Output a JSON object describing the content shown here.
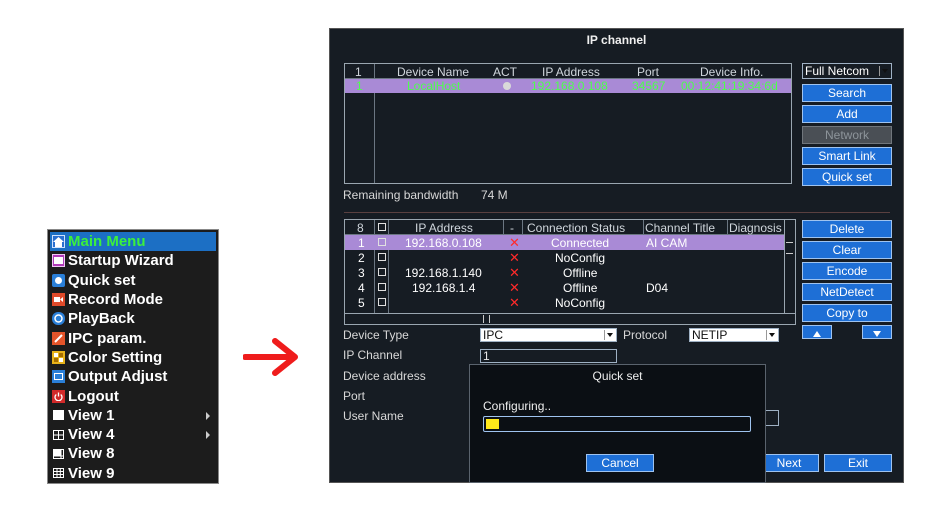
{
  "menu": {
    "items": [
      {
        "label": "Main Menu",
        "icon": "home-icon"
      },
      {
        "label": "Startup Wizard",
        "icon": "wizard-icon"
      },
      {
        "label": "Quick set",
        "icon": "quickset-icon"
      },
      {
        "label": "Record Mode",
        "icon": "record-icon"
      },
      {
        "label": "PlayBack",
        "icon": "playback-icon"
      },
      {
        "label": "IPC param.",
        "icon": "ipc-param-icon"
      },
      {
        "label": "Color Setting",
        "icon": "color-setting-icon"
      },
      {
        "label": "Output Adjust",
        "icon": "output-adjust-icon"
      },
      {
        "label": "Logout",
        "icon": "logout-icon"
      },
      {
        "label": "View 1",
        "icon": "view1-icon"
      },
      {
        "label": "View 4",
        "icon": "view4-icon"
      },
      {
        "label": "View 8",
        "icon": "view8-icon"
      },
      {
        "label": "View 9",
        "icon": "view9-icon"
      }
    ],
    "colors": {
      "selected_bg": "#1c6fc4",
      "selected_text": "#3cf03c"
    }
  },
  "window": {
    "title": "IP channel",
    "netcom_select": "Full Netcom",
    "search_table": {
      "count": "1",
      "headers": [
        "Device Name",
        "ACT",
        "IP Address",
        "Port",
        "Device Info."
      ],
      "rows": [
        {
          "index": "1",
          "name": "LocalHost",
          "ip": "192.168.0.108",
          "port": "34567",
          "info": "00:12:41:19:34:6d"
        }
      ]
    },
    "buttons_top": [
      "Search",
      "Add",
      "Network",
      "Smart Link",
      "Quick set"
    ],
    "bandwidth_label": "Remaining bandwidth",
    "bandwidth_value": "74 M",
    "channel_table": {
      "count": "8",
      "headers": [
        "IP Address",
        "-",
        "Connection Status",
        "Channel Title",
        "Diagnosis"
      ],
      "rows": [
        {
          "index": "1",
          "ip": "192.168.0.108",
          "status": "Connected",
          "title": "AI CAM"
        },
        {
          "index": "2",
          "ip": "",
          "status": "NoConfig",
          "title": ""
        },
        {
          "index": "3",
          "ip": "192.168.1.140",
          "status": "Offline",
          "title": ""
        },
        {
          "index": "4",
          "ip": "192.168.1.4",
          "status": "Offline",
          "title": "D04"
        },
        {
          "index": "5",
          "ip": "",
          "status": "NoConfig",
          "title": ""
        }
      ]
    },
    "buttons_mid": [
      "Delete",
      "Clear",
      "Encode",
      "NetDetect",
      "Copy to"
    ],
    "form": {
      "device_type_label": "Device Type",
      "device_type_value": "IPC",
      "protocol_label": "Protocol",
      "protocol_value": "NETIP",
      "ip_channel_label": "IP Channel",
      "ip_channel_value": "1",
      "device_address_label": "Device address",
      "port_label": "Port",
      "user_name_label": "User Name"
    },
    "next_label": "Next",
    "exit_label": "Exit"
  },
  "quickset_dialog": {
    "title": "Quick set",
    "message": "Configuring..",
    "progress": 0.05,
    "cancel_label": "Cancel"
  }
}
